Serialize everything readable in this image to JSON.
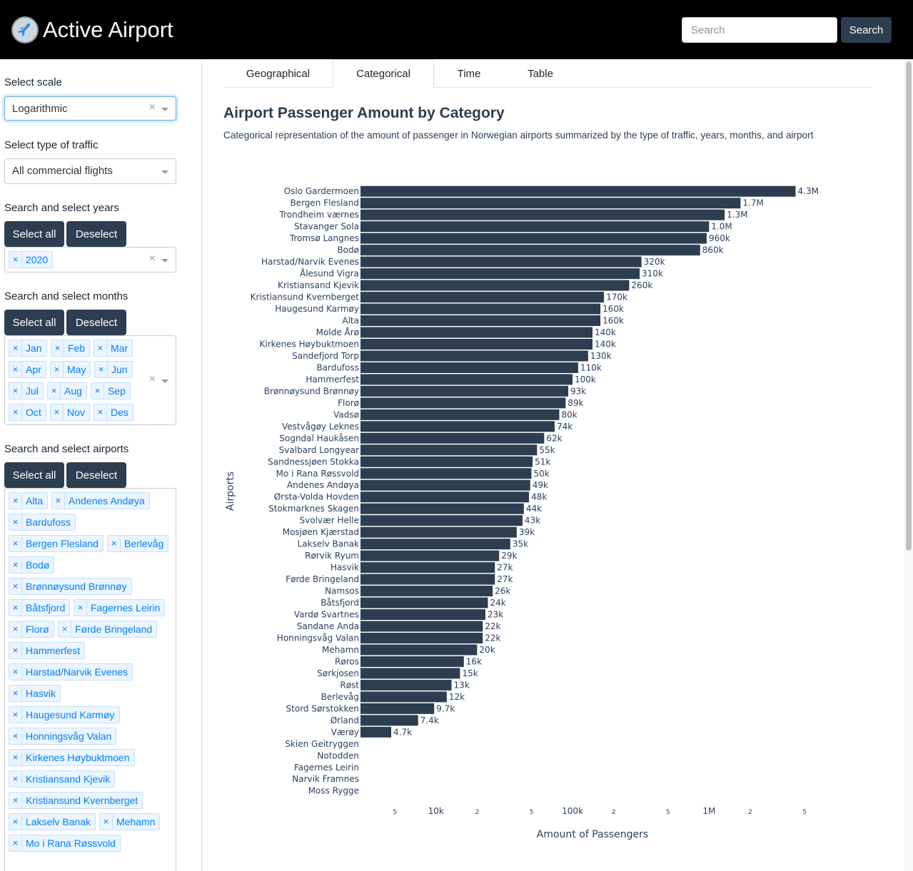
{
  "header": {
    "app_title": "Active Airport",
    "search_placeholder": "Search",
    "search_button": "Search"
  },
  "sidebar": {
    "scale_label": "Select scale",
    "scale_value": "Logarithmic",
    "traffic_label": "Select type of traffic",
    "traffic_value": "All commercial flights",
    "years_label": "Search and select years",
    "years_select_all": "Select all",
    "years_deselect": "Deselect",
    "years_selected": [
      "2020"
    ],
    "months_label": "Search and select months",
    "months_select_all": "Select all",
    "months_deselect": "Deselect",
    "months_selected": [
      "Jan",
      "Feb",
      "Mar",
      "Apr",
      "May",
      "Jun",
      "Jul",
      "Aug",
      "Sep",
      "Oct",
      "Nov",
      "Des"
    ],
    "airports_label": "Search and select airports",
    "airports_select_all": "Select all",
    "airports_deselect": "Deselect",
    "airports_selected": [
      "Alta",
      "Andenes Andøya",
      "Bardufoss",
      "Bergen Flesland",
      "Berlevåg",
      "Bodø",
      "Brønnøysund Brønnøy",
      "Båtsfjord",
      "Fagernes Leirin",
      "Florø",
      "Førde Bringeland",
      "Hammerfest",
      "Harstad/Narvik Evenes",
      "Hasvik",
      "Haugesund Karmøy",
      "Honningsvåg Valan",
      "Kirkenes Høybuktmoen",
      "Kristiansand Kjevik",
      "Kristiansund Kvernberget",
      "Lakselv Banak",
      "Mehamn",
      "Mo i Rana Røssvold"
    ],
    "clear_symbol": "×"
  },
  "tabs": [
    "Geographical",
    "Categorical",
    "Time",
    "Table"
  ],
  "active_tab": "Categorical",
  "main": {
    "title": "Airport Passenger Amount by Category",
    "description": "Categorical representation of the amount of passenger in Norwegian airports summarized by the type of traffic, years, months, and airport"
  },
  "colors": {
    "bar": "#2c3e50",
    "header_bg": "#000000",
    "button_bg": "#2c3e50",
    "chip_text": "#007eff"
  },
  "chart_data": {
    "type": "bar",
    "orientation": "horizontal",
    "xlabel": "Amount of Passengers",
    "ylabel": "Airports",
    "x_scale": "log",
    "xlim": [
      2800,
      7000000
    ],
    "x_ticks": [
      {
        "value": 5000,
        "label": "5"
      },
      {
        "value": 10000,
        "label": "10k"
      },
      {
        "value": 20000,
        "label": "2"
      },
      {
        "value": 50000,
        "label": "5"
      },
      {
        "value": 100000,
        "label": "100k"
      },
      {
        "value": 200000,
        "label": "2"
      },
      {
        "value": 500000,
        "label": "5"
      },
      {
        "value": 1000000,
        "label": "1M"
      },
      {
        "value": 2000000,
        "label": "2"
      },
      {
        "value": 5000000,
        "label": "5"
      }
    ],
    "categories": [
      "Oslo Gardermoen",
      "Bergen Flesland",
      "Trondheim værnes",
      "Stavanger Sola",
      "Tromsø Langnes",
      "Bodø",
      "Harstad/Narvik Evenes",
      "Ålesund Vigra",
      "Kristiansand Kjevik",
      "Kristiansund Kvernberget",
      "Haugesund Karmøy",
      "Alta",
      "Molde Årø",
      "Kirkenes Høybuktmoen",
      "Sandefjord Torp",
      "Bardufoss",
      "Hammerfest",
      "Brønnøysund Brønnøy",
      "Florø",
      "Vadsø",
      "Vestvågøy Leknes",
      "Sogndal Haukåsen",
      "Svalbard Longyear",
      "Sandnessjøen Stokka",
      "Mo i Rana Røssvold",
      "Andenes Andøya",
      "Ørsta-Volda Hovden",
      "Stokmarknes Skagen",
      "Svolvær Helle",
      "Mosjøen Kjærstad",
      "Lakselv Banak",
      "Rørvik Ryum",
      "Hasvik",
      "Førde Bringeland",
      "Namsos",
      "Båtsfjord",
      "Vardø Svartnes",
      "Sandane Anda",
      "Honningsvåg Valan",
      "Mehamn",
      "Røros",
      "Sørkjosen",
      "Røst",
      "Berlevåg",
      "Stord Sørstokken",
      "Ørland",
      "Værøy",
      "Skien Geitryggen",
      "Notodden",
      "Fagernes Leirin",
      "Narvik Framnes",
      "Moss Rygge"
    ],
    "values": [
      4300000,
      1700000,
      1300000,
      1000000,
      960000,
      860000,
      320000,
      310000,
      260000,
      170000,
      160000,
      160000,
      140000,
      140000,
      130000,
      110000,
      100000,
      93000,
      89000,
      80000,
      74000,
      62000,
      55000,
      51000,
      50000,
      49000,
      48000,
      44000,
      43000,
      39000,
      35000,
      29000,
      27000,
      27000,
      26000,
      24000,
      23000,
      22000,
      22000,
      20000,
      16000,
      15000,
      13000,
      12000,
      9700,
      7400,
      4700,
      null,
      null,
      null,
      null,
      null
    ],
    "data_labels": [
      "4.3M",
      "1.7M",
      "1.3M",
      "1.0M",
      "960k",
      "860k",
      "320k",
      "310k",
      "260k",
      "170k",
      "160k",
      "160k",
      "140k",
      "140k",
      "130k",
      "110k",
      "100k",
      "93k",
      "89k",
      "80k",
      "74k",
      "62k",
      "55k",
      "51k",
      "50k",
      "49k",
      "48k",
      "44k",
      "43k",
      "39k",
      "35k",
      "29k",
      "27k",
      "27k",
      "26k",
      "24k",
      "23k",
      "22k",
      "22k",
      "20k",
      "16k",
      "15k",
      "13k",
      "12k",
      "9.7k",
      "7.4k",
      "4.7k",
      "",
      "",
      "",
      "",
      ""
    ],
    "grid": false,
    "legend": "none"
  }
}
